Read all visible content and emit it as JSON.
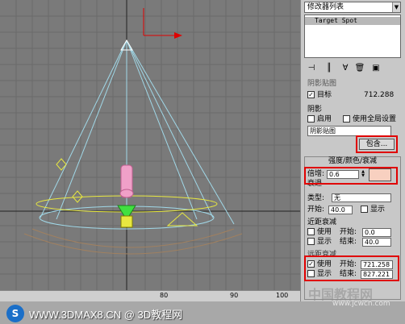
{
  "viewport": {
    "colors": {
      "background": "#7a7a7a",
      "cone": "#a0d8e8",
      "light_body": "#f0a0c8",
      "target": "#40e040",
      "gizmo": "#e8e840",
      "axis_red": "#e00000"
    }
  },
  "ruler": {
    "ticks": [
      "80",
      "90",
      "100"
    ]
  },
  "panel": {
    "modifier_list": "修改器列表",
    "stack_item": "Target Spot",
    "general": {
      "shadow_type_partial": "阴影贴图",
      "target_label": "目标",
      "target_value": "712.288",
      "shadow_header": "阴影",
      "enable_label": "启用",
      "global_label": "使用全局设置",
      "shadow_map_label": "阴影贴图",
      "exclude_button": "包含..."
    },
    "intensity": {
      "title": "强度/颜色/衰减",
      "multiplier_label": "倍增:",
      "multiplier_value": "0.6",
      "multiplier_color": "#f8d0c0",
      "decay_label": "衰退",
      "type_label": "类型:",
      "type_value": "无",
      "start_label": "开始:",
      "start_value": "40.0",
      "show_label": "显示",
      "near_title": "近距衰减",
      "near_use": "使用",
      "near_start_label": "开始:",
      "near_start_value": "0.0",
      "near_show": "显示",
      "near_end_label": "结束:",
      "near_end_value": "40.0",
      "far_title": "远距衰减",
      "far_use": "使用",
      "far_start_label": "开始:",
      "far_start_value": "721.258",
      "far_show": "显示",
      "far_end_label": "结束:",
      "far_end_value": "827.221"
    }
  },
  "watermark": {
    "logo": "S",
    "text": "WWW.3DMAX8.CN @ 3D教程网",
    "site2": "中国教程网",
    "site3": "www.jcwcn.com"
  }
}
